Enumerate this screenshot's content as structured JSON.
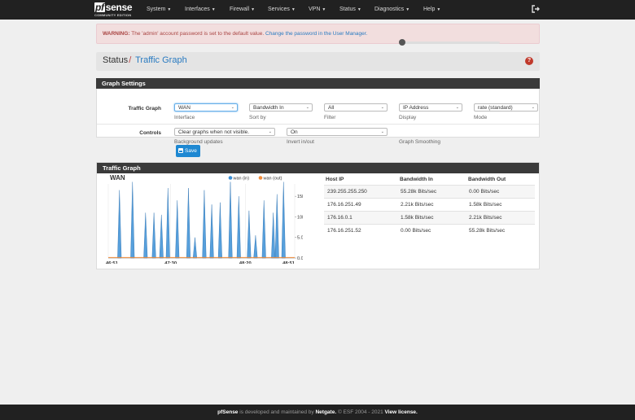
{
  "brand": {
    "logo_pf": "pf",
    "logo_main": "sense",
    "logo_sub": "COMMUNITY EDITION"
  },
  "nav": {
    "items": [
      {
        "label": "System"
      },
      {
        "label": "Interfaces"
      },
      {
        "label": "Firewall"
      },
      {
        "label": "Services"
      },
      {
        "label": "VPN"
      },
      {
        "label": "Status"
      },
      {
        "label": "Diagnostics"
      },
      {
        "label": "Help"
      }
    ],
    "logout_icon": "sign-out-icon"
  },
  "alert": {
    "prefix": "WARNING:",
    "text": " The 'admin' account password is set to the default value. ",
    "link": "Change the password in the User Manager."
  },
  "breadcrumb": {
    "section": "Status",
    "separator": "/",
    "page": "Traffic Graph",
    "help_icon": "question-circle-icon"
  },
  "settings": {
    "title": "Graph Settings",
    "row1": {
      "label": "Traffic Graph",
      "interface": {
        "value": "WAN",
        "help": "Interface"
      },
      "sort": {
        "value": "Bandwidth In",
        "help": "Sort by"
      },
      "filter": {
        "value": "All",
        "help": "Filter"
      },
      "display": {
        "value": "IP Address",
        "help": "Display"
      },
      "mode": {
        "value": "rate (standard)",
        "help": "Mode"
      }
    },
    "row2": {
      "label": "Controls",
      "background": {
        "value": "Clear graphs when not visible.",
        "help": "Background updates"
      },
      "invert": {
        "value": "On",
        "help": "Invert in/out"
      },
      "smoothing": {
        "value": 0,
        "help": "Graph Smoothing"
      }
    },
    "save_label": "Save",
    "save_icon": "save-icon"
  },
  "traffic": {
    "title": "Traffic Graph",
    "graph_title": "WAN",
    "legend": [
      {
        "name": "wan (in)",
        "color": "#3a8fd6"
      },
      {
        "name": "wan (out)",
        "color": "#f28c3a"
      }
    ],
    "table": {
      "headers": [
        "Host IP",
        "Bandwidth In",
        "Bandwidth Out"
      ],
      "rows": [
        [
          "239.255.255.250",
          "55.28k Bits/sec",
          "0.00 Bits/sec"
        ],
        [
          "176.16.251.49",
          "2.21k Bits/sec",
          "1.58k Bits/sec"
        ],
        [
          "176.16.0.1",
          "1.58k Bits/sec",
          "2.21k Bits/sec"
        ],
        [
          "176.16.251.52",
          "0.00 Bits/sec",
          "55.28k Bits/sec"
        ]
      ]
    }
  },
  "chart_data": {
    "type": "area",
    "title": "WAN",
    "y_ticks": [
      "15M",
      "10M",
      "5.0M",
      "0.0"
    ],
    "y_tick_values": [
      15,
      10,
      5,
      0
    ],
    "ylim": [
      0,
      18
    ],
    "x_ticks": [
      "46:51",
      "47:30",
      "48:20",
      "48:51"
    ],
    "x_tick_positions": [
      0,
      0.335,
      0.735,
      1
    ],
    "series": [
      {
        "name": "wan (in)",
        "color": "#3a8fd6",
        "x": [
          0.06,
          0.13,
          0.2,
          0.245,
          0.285,
          0.32,
          0.37,
          0.43,
          0.465,
          0.515,
          0.555,
          0.6,
          0.655,
          0.7,
          0.755,
          0.79,
          0.835,
          0.885,
          0.905,
          0.94
        ],
        "values": [
          16.5,
          18.5,
          11,
          11,
          10.5,
          17,
          14,
          17,
          5,
          16.5,
          13,
          13.5,
          18.5,
          15,
          11.5,
          5.5,
          14,
          11,
          15.5,
          18.5
        ]
      },
      {
        "name": "wan (out)",
        "color": "#f28c3a",
        "values": [
          0
        ]
      }
    ]
  },
  "footer": {
    "brand": "pfSense",
    "text1": " is developed and maintained by ",
    "company": "Netgate.",
    "text2": " © ESF 2004 - 2021 ",
    "license": "View license."
  }
}
